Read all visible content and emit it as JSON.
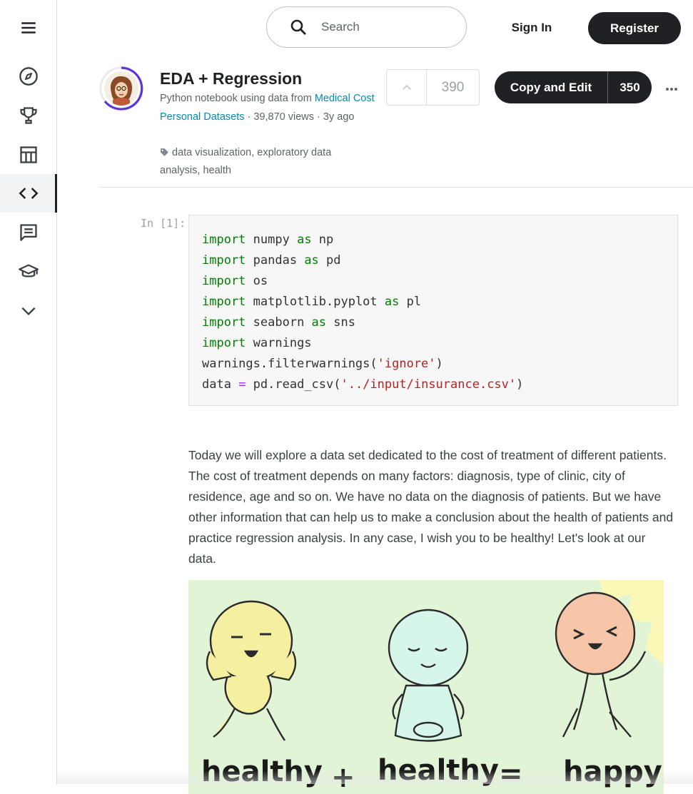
{
  "sidebar": {
    "items": [
      {
        "name": "menu",
        "icon": "hamburger-menu-icon"
      },
      {
        "name": "explore",
        "icon": "compass-icon"
      },
      {
        "name": "competitions",
        "icon": "trophy-icon"
      },
      {
        "name": "datasets",
        "icon": "table-icon"
      },
      {
        "name": "code",
        "icon": "code-brackets-icon",
        "active": true
      },
      {
        "name": "discussions",
        "icon": "comments-icon"
      },
      {
        "name": "learn",
        "icon": "graduation-cap-icon"
      },
      {
        "name": "more",
        "icon": "chevron-down-icon"
      }
    ]
  },
  "header": {
    "search_placeholder": "Search",
    "sign_in": "Sign In",
    "register": "Register"
  },
  "notebook": {
    "title": "EDA + Regression",
    "meta_prefix": "Python notebook using data from ",
    "dataset_link": "Medical Cost Personal Datasets",
    "views": " · 39,870 views · ",
    "age": "3y ago",
    "tags": "data visualization, exploratory data analysis, health",
    "votes": "390",
    "copy_edit_label": "Copy and Edit",
    "copy_edit_count": "350"
  },
  "cell": {
    "prompt": "In [1]:",
    "lines": [
      [
        [
          "kw",
          "import"
        ],
        [
          "t",
          " numpy "
        ],
        [
          "kw",
          "as"
        ],
        [
          "t",
          " np"
        ]
      ],
      [
        [
          "kw",
          "import"
        ],
        [
          "t",
          " pandas "
        ],
        [
          "kw",
          "as"
        ],
        [
          "t",
          " pd"
        ]
      ],
      [
        [
          "kw",
          "import"
        ],
        [
          "t",
          " os"
        ]
      ],
      [
        [
          "kw",
          "import"
        ],
        [
          "t",
          " matplotlib.pyplot "
        ],
        [
          "kw",
          "as"
        ],
        [
          "t",
          " pl"
        ]
      ],
      [
        [
          "kw",
          "import"
        ],
        [
          "t",
          " seaborn "
        ],
        [
          "kw",
          "as"
        ],
        [
          "t",
          " sns"
        ]
      ],
      [
        [
          "kw",
          "import"
        ],
        [
          "t",
          " warnings"
        ]
      ],
      [
        [
          "t",
          "warnings.filterwarnings("
        ],
        [
          "str",
          "'ignore'"
        ],
        [
          "t",
          ")"
        ]
      ],
      [
        [
          "t",
          "data "
        ],
        [
          "op",
          "="
        ],
        [
          "t",
          " pd.read_csv("
        ],
        [
          "str",
          "'../input/insurance.csv'"
        ],
        [
          "t",
          ")"
        ]
      ]
    ]
  },
  "markdown": {
    "text": "Today we will explore a data set dedicated to the cost of treatment of different patients. The cost of treatment depends on many factors: diagnosis, type of clinic, city of residence, age and so on. We have no data on the diagnosis of patients. But we have other information that can help us to make a conclusion about the health of patients and practice regression analysis. In any case, I wish you to be healthy! Let's look at our data.",
    "image_words": [
      "healthy",
      "+",
      "healthy",
      "=",
      "happy"
    ]
  },
  "colors": {
    "accent": "#202124",
    "link": "#008abc",
    "keyword": "#008000",
    "string": "#ba2121",
    "avatar_ring": "#5e35d9"
  }
}
